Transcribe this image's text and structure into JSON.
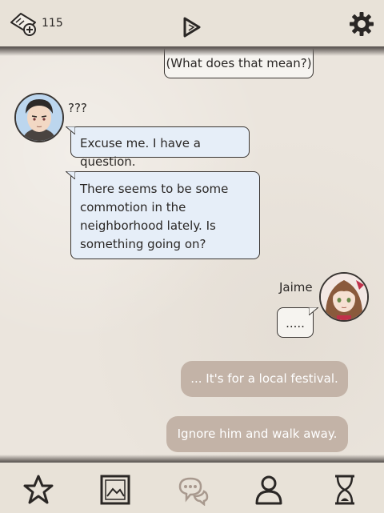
{
  "topbar": {
    "ticket_count": "115",
    "icons": [
      "ticket-add-icon",
      "play-icon",
      "gear-icon"
    ]
  },
  "chat": {
    "messages": [
      {
        "side": "right",
        "speaker": "",
        "text": "(What does that mean?)"
      },
      {
        "side": "left",
        "speaker": "???",
        "text": "Excuse me. I have a question."
      },
      {
        "side": "left",
        "speaker": "",
        "text": "There seems to be some commotion in the neighborhood lately. Is something going on?"
      },
      {
        "side": "right",
        "speaker": "Jaime",
        "text": "....."
      }
    ]
  },
  "choices": [
    {
      "label": "... It's for a local festival."
    },
    {
      "label": "Ignore him and walk away."
    }
  ],
  "bottom_nav": {
    "items": [
      "star-icon",
      "gallery-icon",
      "chat-icon",
      "profile-icon",
      "hourglass-icon"
    ],
    "active": "chat-icon"
  },
  "colors": {
    "background": "#ebe5dd",
    "left_bubble": "#e6eef8",
    "choice": "#c3b3a7",
    "outline": "#3a3633"
  }
}
